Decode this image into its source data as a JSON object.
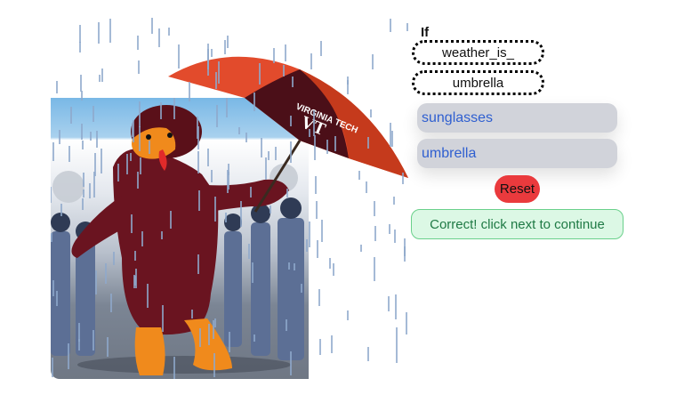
{
  "rule": {
    "title": "If",
    "condition": "weather_is_",
    "consequence": "umbrella"
  },
  "options": [
    "sunglasses",
    "umbrella"
  ],
  "reset_label": "Reset",
  "status_text": "Correct! click next to continue",
  "umbrella_text": "VIRGINIA TECH",
  "umbrella_logo": "VT",
  "colors": {
    "option_bg": "#d1d3da",
    "option_text": "#2f5fd0",
    "reset_bg": "#ea3a3d",
    "status_bg": "#dcf8e5",
    "status_border": "#6ad08b",
    "status_text": "#1f7a45"
  }
}
